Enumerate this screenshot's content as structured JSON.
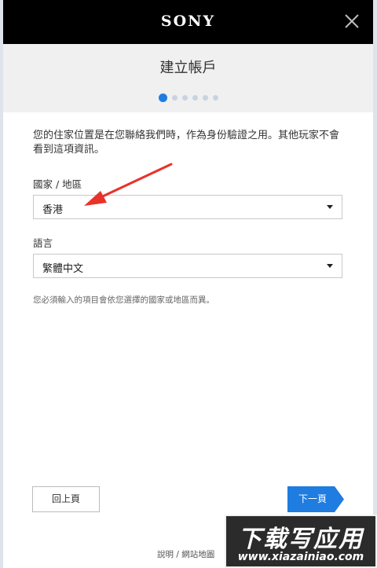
{
  "header": {
    "brand": "SONY"
  },
  "dialog": {
    "title": "建立帳戶",
    "step_dots": {
      "total": 6,
      "current": 1
    },
    "description": "您的住家位置是在您聯絡我們時，作為身份驗證之用。其他玩家不會看到這項資訊。",
    "country": {
      "label": "國家 / 地區",
      "value": "香港"
    },
    "language": {
      "label": "語言",
      "value": "繁體中文"
    },
    "note": "您必須輸入的項目會依您選擇的國家或地區而異。",
    "back_label": "回上頁",
    "next_label": "下一頁"
  },
  "footer": {
    "help": "說明",
    "separator": "/",
    "sitemap": "網站地圖"
  },
  "watermark": {
    "main": "下载写应用",
    "url": "www.xiazainiao.com"
  },
  "colors": {
    "accent": "#1f7ce0",
    "top_bar": "#000000",
    "title_bar": "#f0f0f0",
    "annotation_arrow": "#e8322a"
  }
}
